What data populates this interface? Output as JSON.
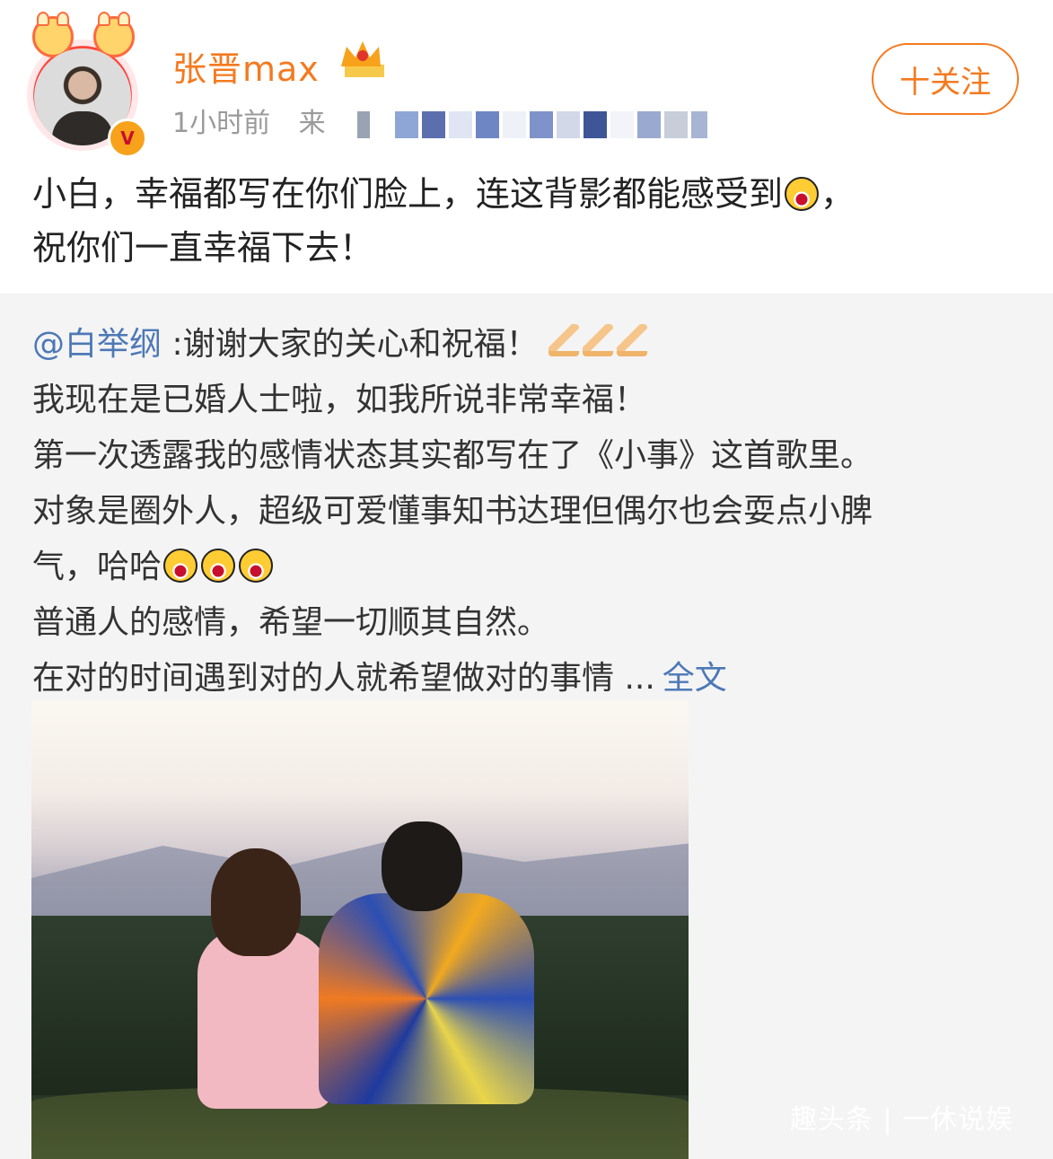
{
  "post": {
    "username": "张晋max",
    "time": "1小时前",
    "source_prefix": "来",
    "follow_label": "十关注",
    "text_line1": "小白，幸福都写在你们脸上，连这背影都能感受到",
    "text_line1_end": "，",
    "text_line2": "祝你们一直幸福下去！"
  },
  "repost": {
    "mention": "@白举纲",
    "line1": " :谢谢大家的关心和祝福！",
    "line2": "我现在是已婚人士啦，如我所说非常幸福！",
    "line3": "第一次透露我的感情状态其实都写在了《小事》这首歌里。",
    "line4": "对象是圈外人，超级可爱懂事知书达理但偶尔也会耍点小脾",
    "line5": "气，哈哈",
    "line6": "普通人的感情，希望一切顺其自然。",
    "line7": "在对的时间遇到对的人就希望做对的事情 ...",
    "more": "全文"
  },
  "watermark": "趣头条 | 一休说娱",
  "icons": {
    "emoji_laugh": "laughing-emoji-icon",
    "pray": "pray-hands-icon",
    "crown": "crown-icon",
    "verified": "verified-v-icon"
  },
  "colors": {
    "accent_orange": "#f47a1f",
    "link_blue": "#4d78b6",
    "repost_bg": "#f4f4f4"
  }
}
